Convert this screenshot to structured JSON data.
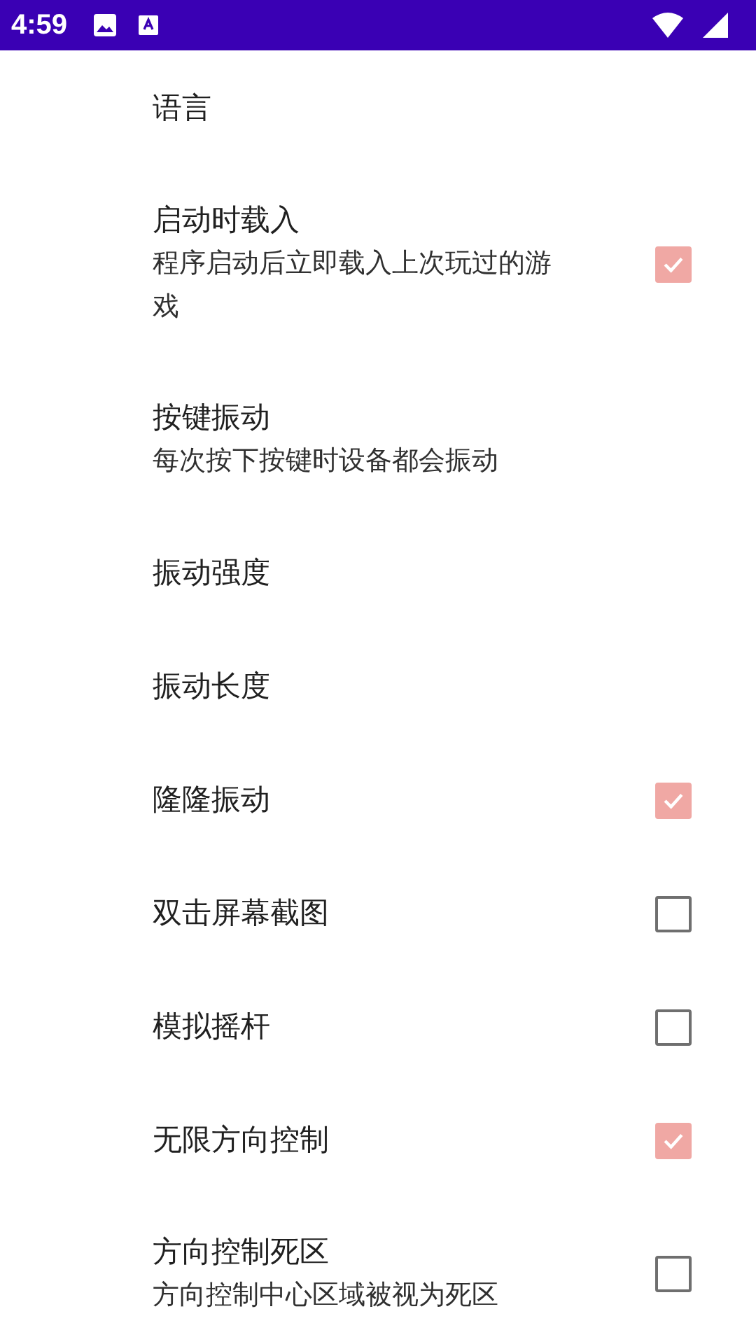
{
  "status_bar": {
    "time": "4:59"
  },
  "settings": [
    {
      "title": "语言"
    },
    {
      "title": "启动时载入",
      "summary": "程序启动后立即载入上次玩过的游戏",
      "checked": true
    },
    {
      "title": "按键振动",
      "summary": "每次按下按键时设备都会振动"
    },
    {
      "title": "振动强度"
    },
    {
      "title": "振动长度"
    },
    {
      "title": "隆隆振动",
      "checked": true
    },
    {
      "title": "双击屏幕截图",
      "checked": false
    },
    {
      "title": "模拟摇杆",
      "checked": false
    },
    {
      "title": "无限方向控制",
      "checked": true
    },
    {
      "title": "方向控制死区",
      "summary": "方向控制中心区域被视为死区",
      "checked": false
    }
  ]
}
